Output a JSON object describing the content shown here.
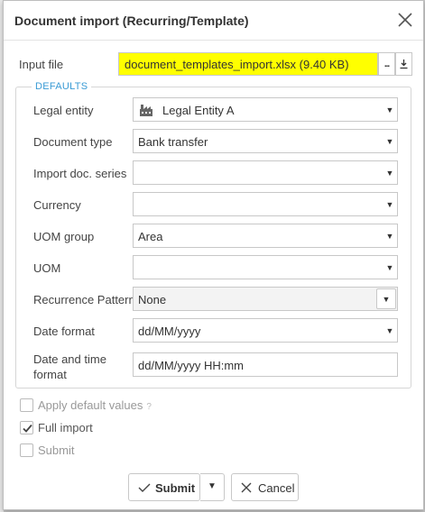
{
  "dialog": {
    "title": "Document import (Recurring/Template)"
  },
  "input_file": {
    "label": "Input file",
    "value": "document_templates_import.xlsx (9.40 KB)",
    "browse_label": "...",
    "highlight_color": "#ffff00"
  },
  "defaults": {
    "legend": "DEFAULTS",
    "legend_color": "#3a9bd5",
    "fields": {
      "legal_entity": {
        "label": "Legal entity",
        "value": "Legal Entity A"
      },
      "document_type": {
        "label": "Document type",
        "value": "Bank transfer"
      },
      "import_doc_series": {
        "label": "Import doc. series",
        "value": ""
      },
      "currency": {
        "label": "Currency",
        "value": ""
      },
      "uom_group": {
        "label": "UOM group",
        "value": "Area"
      },
      "uom": {
        "label": "UOM",
        "value": ""
      },
      "recurrence_pattern": {
        "label": "Recurrence Pattern",
        "value": "None"
      },
      "date_format": {
        "label": "Date format",
        "value": "dd/MM/yyyy"
      },
      "date_time_format": {
        "label_line1": "Date and time",
        "label_line2": "format",
        "value": "dd/MM/yyyy HH:mm"
      }
    }
  },
  "options": {
    "apply_default_values": {
      "label": "Apply default values",
      "help": "?",
      "checked": false
    },
    "full_import": {
      "label": "Full import",
      "checked": true
    },
    "submit_option": {
      "label": "Submit",
      "checked": false
    }
  },
  "footer": {
    "submit_label": "Submit",
    "cancel_label": "Cancel"
  }
}
